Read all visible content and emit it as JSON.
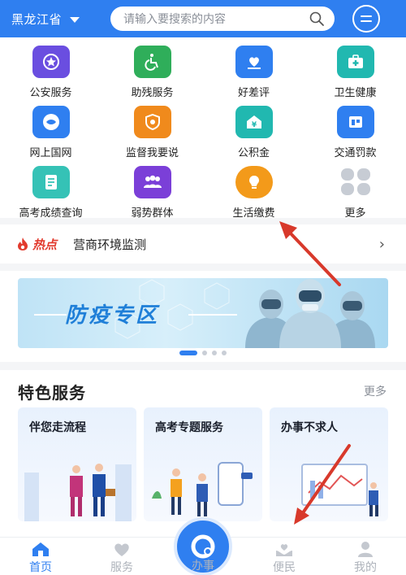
{
  "header": {
    "region": "黑龙江省",
    "search_placeholder": "请输入要搜索的内容"
  },
  "services": [
    {
      "label": "公安服务",
      "icon": "police-badge-icon",
      "color": "#6a4ee0"
    },
    {
      "label": "助残服务",
      "icon": "wheelchair-icon",
      "color": "#2fae5a"
    },
    {
      "label": "好差评",
      "icon": "heart-hand-icon",
      "color": "#2f7ff0"
    },
    {
      "label": "卫生健康",
      "icon": "medical-kit-icon",
      "color": "#21b8b0"
    },
    {
      "label": "网上国网",
      "icon": "power-grid-icon",
      "color": "#2f7ff0"
    },
    {
      "label": "监督我要说",
      "icon": "shield-icon",
      "color": "#f08a1c"
    },
    {
      "label": "公积金",
      "icon": "housing-fund-icon",
      "color": "#21b8b0"
    },
    {
      "label": "交通罚款",
      "icon": "traffic-ticket-icon",
      "color": "#2f7ff0"
    },
    {
      "label": "高考成绩查询",
      "icon": "score-report-icon",
      "color": "#35c2b6"
    },
    {
      "label": "弱势群体",
      "icon": "group-icon",
      "color": "#7b3fd8"
    },
    {
      "label": "生活缴费",
      "icon": "bill-payment-icon",
      "color": "#f39a1a"
    },
    {
      "label": "更多",
      "icon": "more-grid-icon",
      "color": "#c7ccd4"
    }
  ],
  "hot": {
    "tag": "热点",
    "title": "营商环境监测"
  },
  "banner": {
    "title": "防疫专区"
  },
  "featured": {
    "title": "特色服务",
    "more": "更多",
    "cards": [
      {
        "title": "伴您走流程"
      },
      {
        "title": "高考专题服务"
      },
      {
        "title": "办事不求人"
      }
    ]
  },
  "tabbar": {
    "tabs": [
      {
        "label": "首页"
      },
      {
        "label": "服务"
      },
      {
        "label": "办事"
      },
      {
        "label": "便民"
      },
      {
        "label": "我的"
      }
    ]
  },
  "colors": {
    "primary": "#2f7ff0",
    "hot": "#e23b2e",
    "annotation_arrow": "#d8392b"
  }
}
